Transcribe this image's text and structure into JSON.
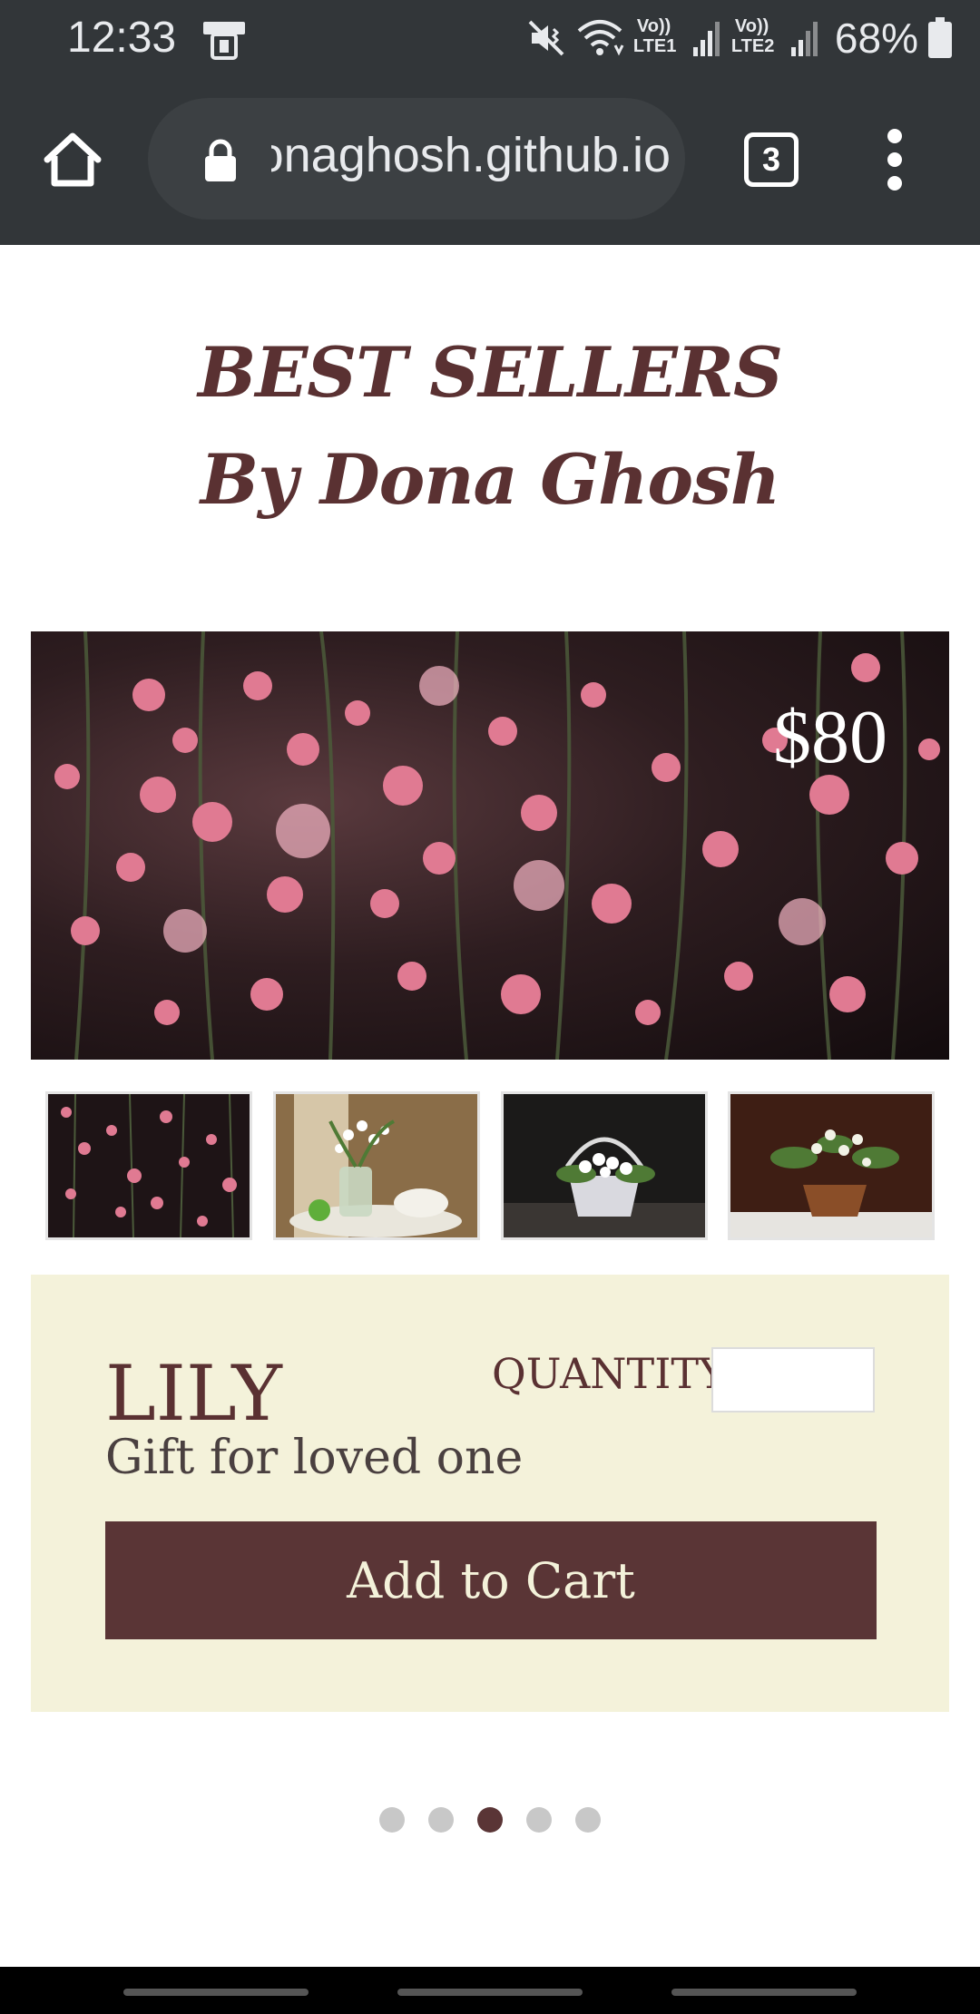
{
  "status_bar": {
    "time": "12:33",
    "battery_text": "68%",
    "icons": [
      "device-icon",
      "mute-icon",
      "wifi-icon",
      "volte-lte1-icon",
      "signal-1-icon",
      "volte-lte2-icon",
      "signal-2-icon",
      "battery-icon"
    ],
    "lte1_label_top": "Vo))",
    "lte1_label_bottom": "LTE1",
    "lte2_label_top": "Vo))",
    "lte2_label_bottom": "LTE2"
  },
  "browser": {
    "url": "donaghosh.github.io",
    "tab_count": "3",
    "icons": [
      "home-icon",
      "lock-icon",
      "tabs-icon",
      "more-vert-icon"
    ]
  },
  "page": {
    "heading_line1": "BEST SELLERS",
    "heading_line2": "By Dona Ghosh",
    "hero_price": "$80",
    "thumbnails": [
      "pink-blossoms",
      "lily-teacup",
      "lily-basket",
      "lily-pot"
    ],
    "product": {
      "name": "LILY",
      "description": "Gift for loved one",
      "quantity_label": "QUANTITY",
      "quantity_value": "",
      "add_to_cart_label": "Add to Cart"
    },
    "carousel": {
      "count": 5,
      "active_index": 2
    }
  },
  "colors": {
    "brand": "#5a3536",
    "panel": "#f4f2da",
    "browser_chrome": "#323639"
  }
}
